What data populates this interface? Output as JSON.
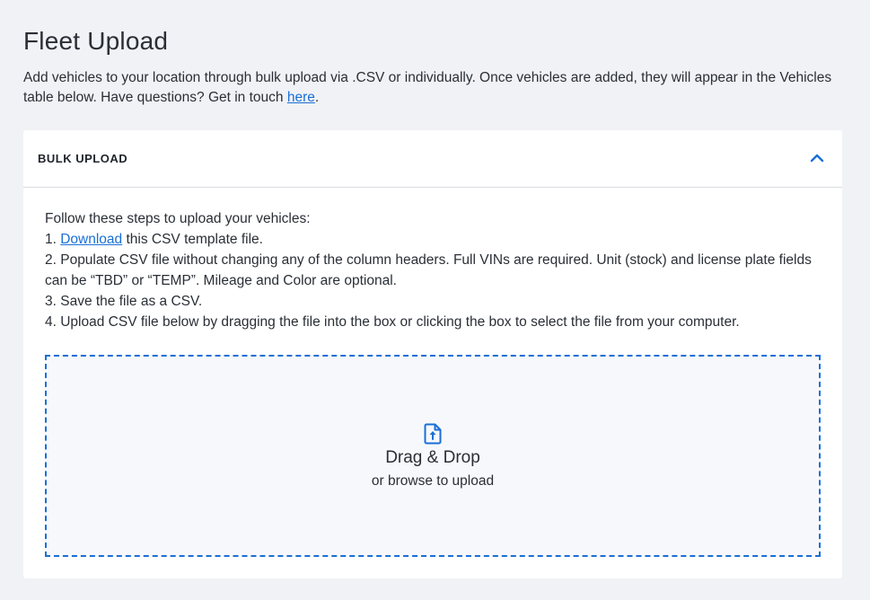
{
  "header": {
    "title": "Fleet Upload"
  },
  "intro": {
    "text_before_link": "Add vehicles to your location through bulk upload via .CSV or individually. Once vehicles are added, they will appear in the Vehicles table below. Have questions? Get in touch ",
    "link_label": "here",
    "text_after_link": "."
  },
  "bulk_upload": {
    "title": "BULK UPLOAD",
    "toggle_icon": "chevron-up-icon",
    "steps_heading": "Follow these steps to upload your vehicles:",
    "step1_prefix": "1. ",
    "step1_link": "Download",
    "step1_suffix": " this CSV template file.",
    "step2": "2. Populate CSV file without changing any of the column headers. Full VINs are required. Unit (stock) and license plate fields can be “TBD” or “TEMP”. Mileage and Color are optional.",
    "step3": "3. Save the file as a CSV.",
    "step4": "4. Upload CSV file below by dragging the file into the box or clicking the box to select the file from your computer.",
    "dropzone": {
      "icon": "file-upload-icon",
      "title": "Drag & Drop",
      "subtitle": "or browse to upload"
    }
  },
  "colors": {
    "accent": "#1a6fd6",
    "background": "#f1f2f5",
    "card": "#ffffff"
  }
}
